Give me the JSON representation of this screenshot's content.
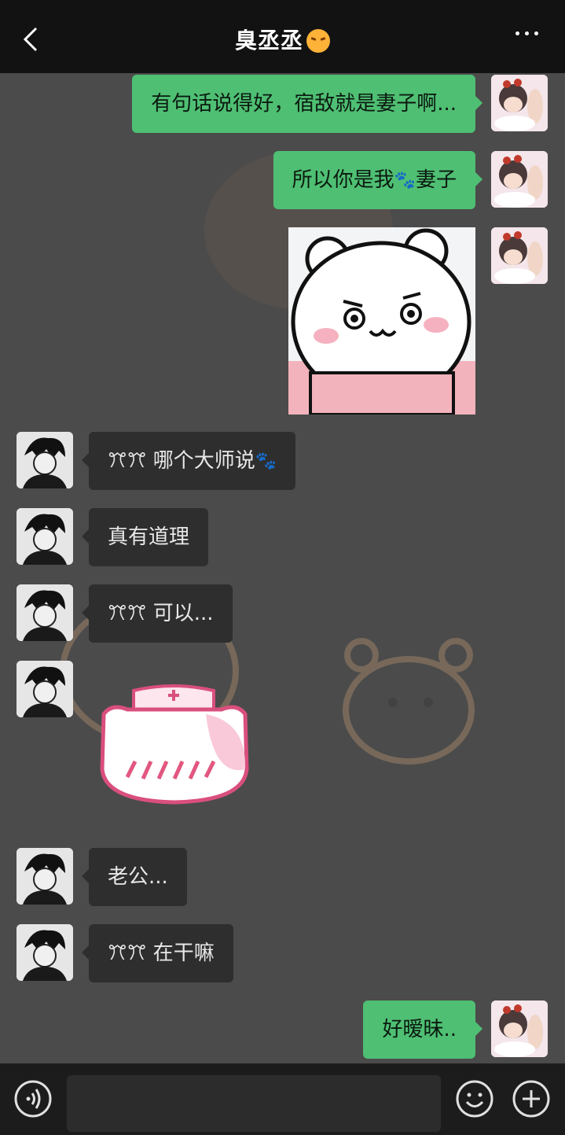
{
  "header": {
    "title": "臭丞丞",
    "title_emoji": "angry-face-emoji"
  },
  "messages": [
    {
      "side": "me",
      "type": "text",
      "text": "有句话说得好，宿敌就是妻子啊..."
    },
    {
      "side": "me",
      "type": "text",
      "text_before": "所以你是我",
      "text_after": "妻子",
      "inline_icon": "paw-icon"
    },
    {
      "side": "me",
      "type": "sticker",
      "sticker": "angry-hamster-sticker"
    },
    {
      "side": "other",
      "type": "text",
      "text": "ꔫꔫ 哪个大师说",
      "inline_icon": "paw-icon"
    },
    {
      "side": "other",
      "type": "text",
      "text": "真有道理"
    },
    {
      "side": "other",
      "type": "text",
      "text": "ꔫꔫ 可以..."
    },
    {
      "side": "other",
      "type": "sticker",
      "sticker": "nurse-cat-sticker"
    },
    {
      "side": "other",
      "type": "text",
      "text": "老公..."
    },
    {
      "side": "other",
      "type": "text",
      "text": "ꔫꔫ 在干嘛"
    },
    {
      "side": "me",
      "type": "text",
      "text": "好暧昧.."
    }
  ],
  "input": {
    "value": "",
    "placeholder": ""
  },
  "colors": {
    "header_bg": "#121212",
    "chat_bg": "#4b4b4b",
    "my_bubble": "#4fbf73",
    "other_bubble": "#2e2e2e",
    "input_bar": "#1c1c1c"
  }
}
